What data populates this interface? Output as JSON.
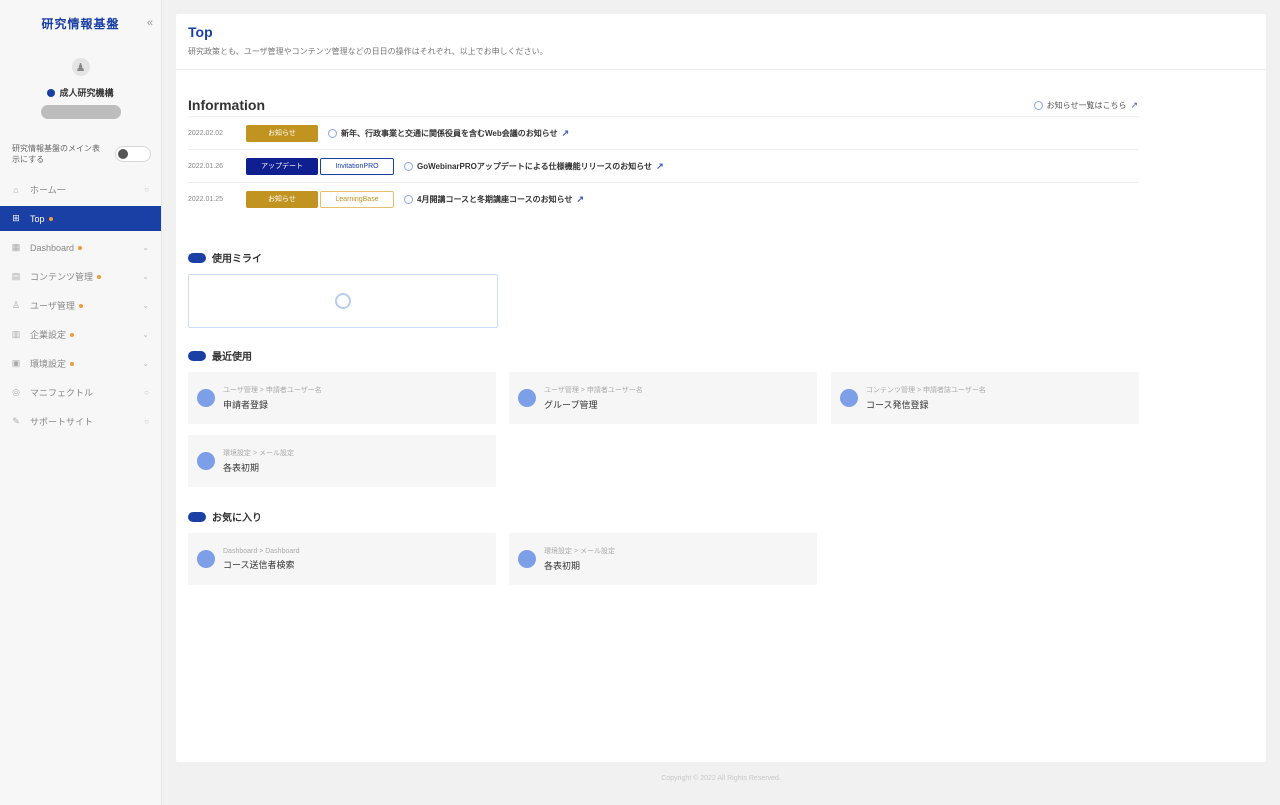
{
  "sidebar": {
    "brand": "研究情報基盤",
    "collapse_icon": "«",
    "org_name": "成人研究機構",
    "toggle_label": "研究情報基盤のメイン表示にする",
    "items": [
      {
        "label": "ホーム一",
        "icon": "home-icon",
        "glyph": "⌂",
        "right": "○",
        "dot": false,
        "active": false
      },
      {
        "label": "Top",
        "icon": "grid-icon",
        "glyph": "⊞",
        "right": "",
        "dot": true,
        "active": true
      },
      {
        "label": "Dashboard",
        "icon": "dashboard-icon",
        "glyph": "▦",
        "right": "⌄",
        "dot": true,
        "active": false
      },
      {
        "label": "コンテンツ管理",
        "icon": "content-icon",
        "glyph": "▤",
        "right": "⌄",
        "dot": true,
        "active": false
      },
      {
        "label": "ユーザ管理",
        "icon": "user-icon",
        "glyph": "♙",
        "right": "⌄",
        "dot": true,
        "active": false
      },
      {
        "label": "企業設定",
        "icon": "building-icon",
        "glyph": "▥",
        "right": "⌄",
        "dot": true,
        "active": false
      },
      {
        "label": "環境設定",
        "icon": "settings-icon",
        "glyph": "▣",
        "right": "⌄",
        "dot": true,
        "active": false
      },
      {
        "label": "マニフェクトル",
        "icon": "manual-icon",
        "glyph": "◎",
        "right": "○",
        "dot": false,
        "active": false
      },
      {
        "label": "サポートサイト",
        "icon": "support-icon",
        "glyph": "✎",
        "right": "○",
        "dot": false,
        "active": false
      }
    ]
  },
  "header": {
    "title": "Top",
    "description": "研究政策とも、ユーザ管理やコンテンツ管理などの日日の操作はそれぞれ、以上でお申しください。"
  },
  "information": {
    "title": "Information",
    "more_label": "お知らせ一覧はこちら",
    "rows": [
      {
        "date": "2022.02.02",
        "tag": "お知らせ",
        "tag_color": "gold",
        "subtag": "",
        "subtag_color": "",
        "text": "新年、行政事業と交通に関係役員を含むWeb会議のお知らせ"
      },
      {
        "date": "2022.01.26",
        "tag": "アップデート",
        "tag_color": "navy",
        "subtag": "InvitationPRO",
        "subtag_color": "outline-blue",
        "text": "GoWebinarPROアップデートによる仕様機能リリースのお知らせ"
      },
      {
        "date": "2022.01.25",
        "tag": "お知らせ",
        "tag_color": "gold",
        "subtag": "LearningBase",
        "subtag_color": "outline-gold",
        "text": "4月開講コースと冬期講座コースのお知らせ"
      }
    ]
  },
  "usage": {
    "title": "使用ミライ"
  },
  "recent": {
    "title": "最近使用",
    "cards": [
      {
        "path": "ユーザ管理 > 申請者ユーザー名",
        "name": "申請者登録"
      },
      {
        "path": "ユーザ管理 > 申請者ユーザー名",
        "name": "グループ管理"
      },
      {
        "path": "コンテンツ管理 > 申請者誌ユーザー名",
        "name": "コース発信登録"
      },
      {
        "path": "環境設定 > メール設定",
        "name": "各表初期"
      }
    ]
  },
  "favorites": {
    "title": "お気に入り",
    "cards": [
      {
        "path": "Dashboard > Dashboard",
        "name": "コース送信者検索"
      },
      {
        "path": "環境設定 > メール設定",
        "name": "各表初期"
      }
    ]
  },
  "footer": "Copyright © 2022 All Rights Reserved."
}
